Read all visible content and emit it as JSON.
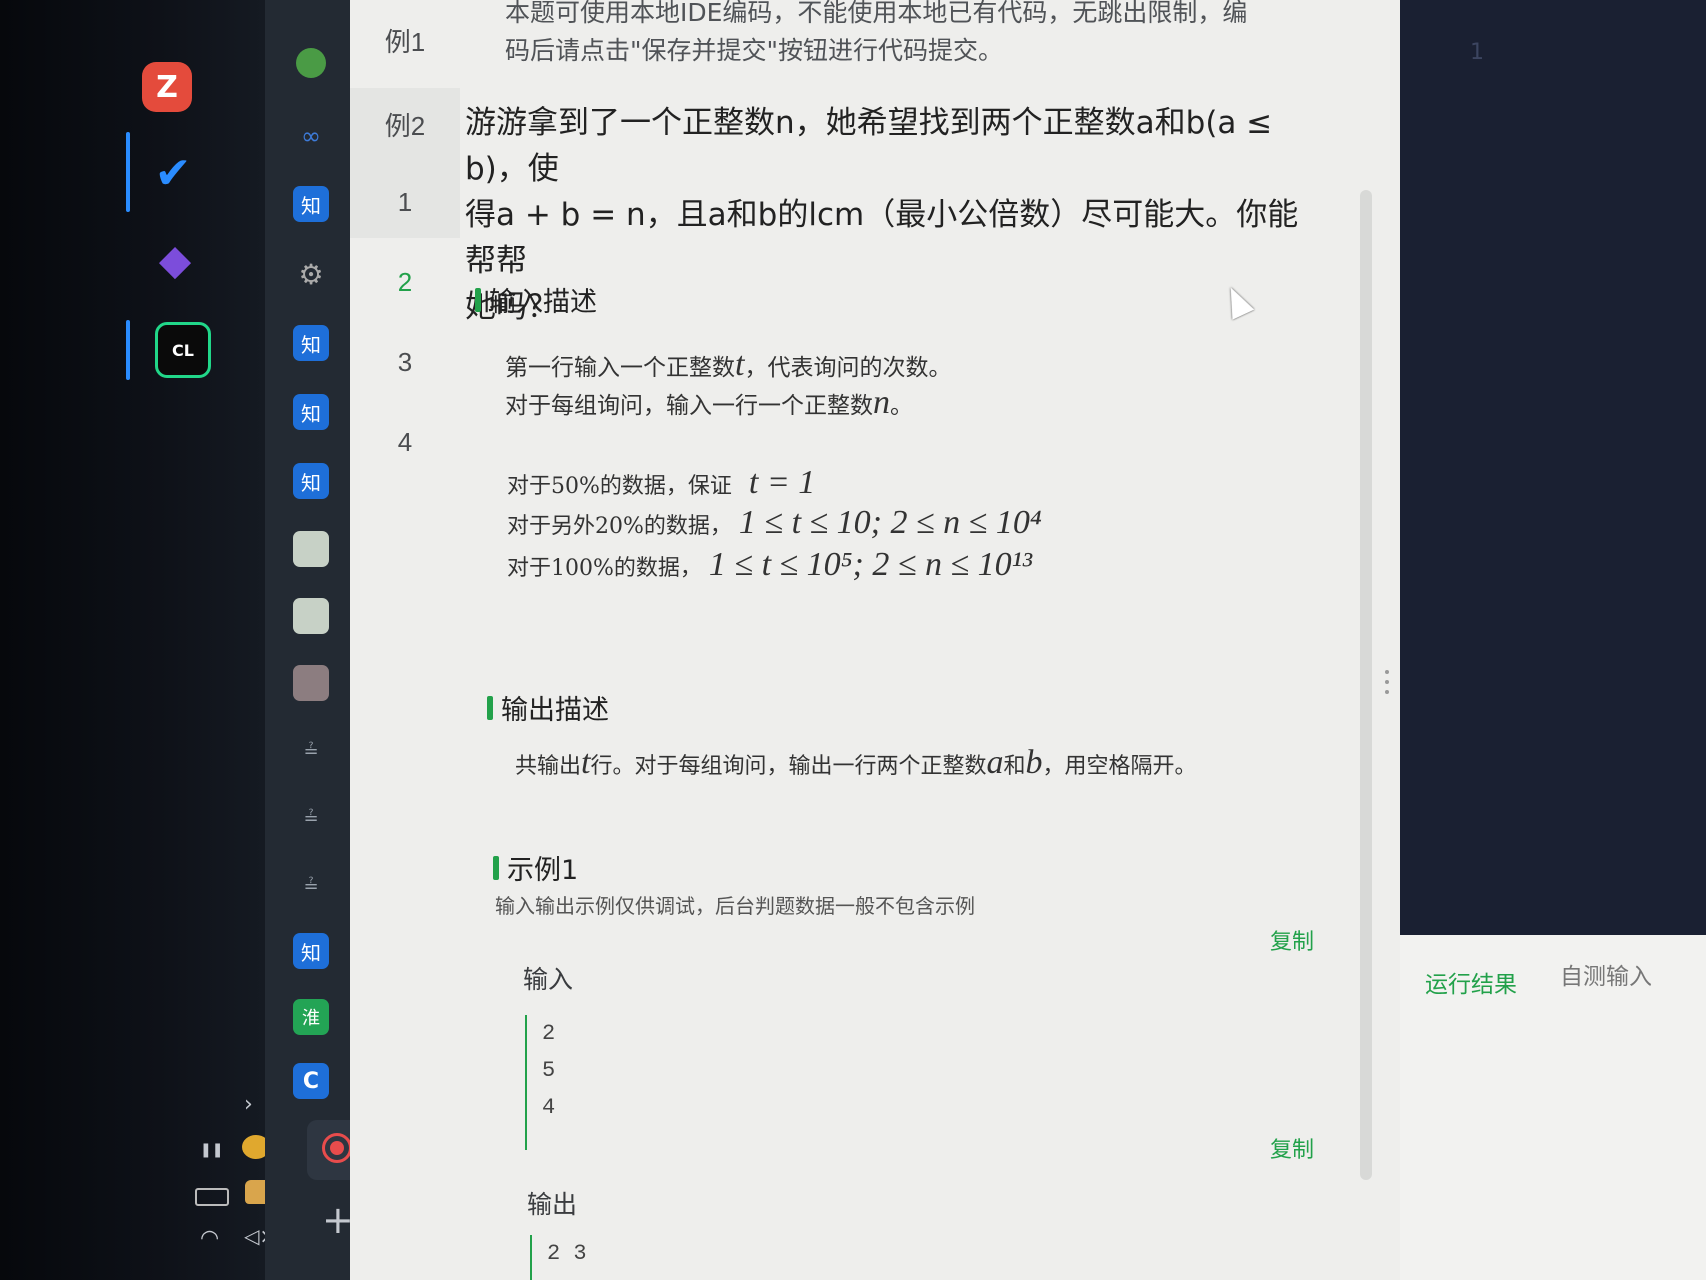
{
  "taskbar": {
    "dock_apps": [
      {
        "name": "zend-app",
        "letter": "Z",
        "color": "#e44b3c"
      },
      {
        "name": "todo-app",
        "letter": "✔",
        "color": "#2a8cff"
      },
      {
        "name": "obsidian-app",
        "letter": "◆",
        "color": "#7c4ddb"
      },
      {
        "name": "clion-app",
        "letter": "CL",
        "color": "#0a0a0a"
      }
    ],
    "side_icons": {
      "zhihu": "知",
      "huai": "淮",
      "c": "C",
      "plus": "+"
    },
    "tray": {
      "expand": "›",
      "pause": "❚❚",
      "wifi": "◠",
      "mute": "◁×"
    }
  },
  "problem_page": {
    "nav": {
      "items": [
        "例1",
        "例2",
        "1",
        "2",
        "3",
        "4"
      ],
      "active_index": 3
    },
    "top_note": {
      "line1": "本题可使用本地IDE编码，不能使用本地已有代码，无跳出限制，编",
      "line2": "码后请点击\"保存并提交\"按钮进行代码提交。"
    },
    "statement": {
      "line1": "游游拿到了一个正整数n，她希望找到两个正整数a和b(a ≤ b)，使",
      "line2": "得a + b = n，且a和b的lcm（最小公倍数）尽可能大。你能帮帮",
      "line3": "她吗？"
    },
    "input_section": {
      "title": "输入描述",
      "line1_pre": "第一行输入一个正整数",
      "line1_var": "t",
      "line1_post": "，代表询问的次数。",
      "line2_pre": "对于每组询问，输入一行一个正整数",
      "line2_var": "n",
      "line2_post": "。",
      "c1_pre": "对于50%的数据，保证",
      "c1_math": "t = 1",
      "c2_pre": "对于另外20%的数据，",
      "c2_math": "1 ≤ t ≤ 10; 2 ≤ n ≤ 10⁴",
      "c3_pre": "对于100%的数据，",
      "c3_math": "1 ≤ t ≤ 10⁵; 2 ≤ n ≤ 10¹³"
    },
    "output_section": {
      "title": "输出描述",
      "pre": "共输出",
      "var": "t",
      "mid": "行。对于每组询问，输出一行两个正整数",
      "var_a": "a",
      "and": "和",
      "var_b": "b",
      "post": "，用空格隔开。"
    },
    "example": {
      "title": "示例1",
      "note": "输入输出示例仅供调试，后台判题数据一般不包含示例",
      "copy_label": "复制",
      "input_label": "输入",
      "input_lines": [
        "2",
        "5",
        "4"
      ],
      "output_label": "输出",
      "output_lines": [
        "2 3"
      ]
    }
  },
  "editor": {
    "line_number": "1"
  },
  "result_panel": {
    "tab_result": "运行结果",
    "tab_custom": "自测输入"
  },
  "colors": {
    "accent": "#22a14a",
    "editor_bg": "#1a2032",
    "page_bg": "#eeeeec"
  }
}
